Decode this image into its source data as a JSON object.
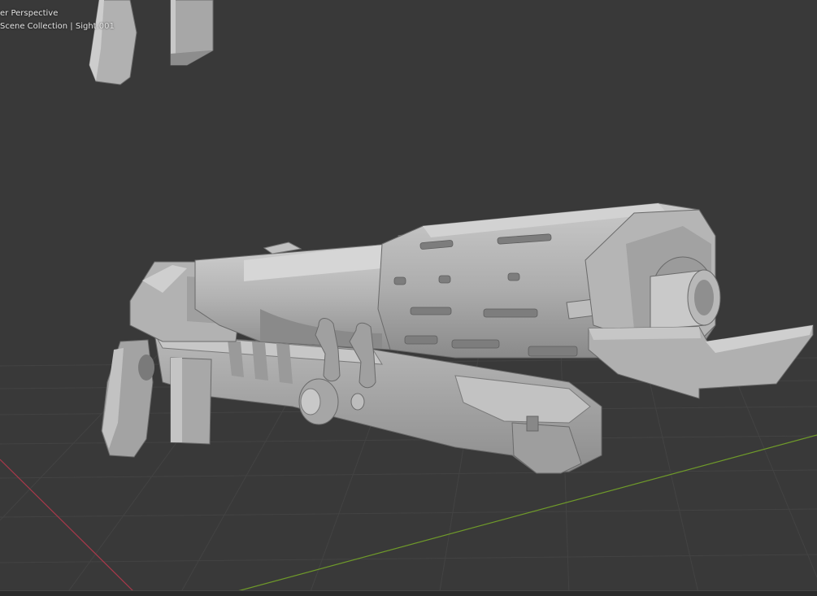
{
  "viewport": {
    "view_name": "er Perspective",
    "collection_info": "Scene Collection | Sight.001"
  },
  "colors": {
    "background": "#393939",
    "grid_line": "#434343",
    "x_axis": "#a8384a",
    "y_axis": "#6f9a2a",
    "model_base": "#a9a9a9",
    "model_light": "#c4c4c4",
    "model_dark": "#7e7e7e",
    "model_shadow": "#5c5c5c",
    "overlay_text": "#e6e6e6"
  },
  "icons": {
    "model": "mesh-object-icon"
  }
}
